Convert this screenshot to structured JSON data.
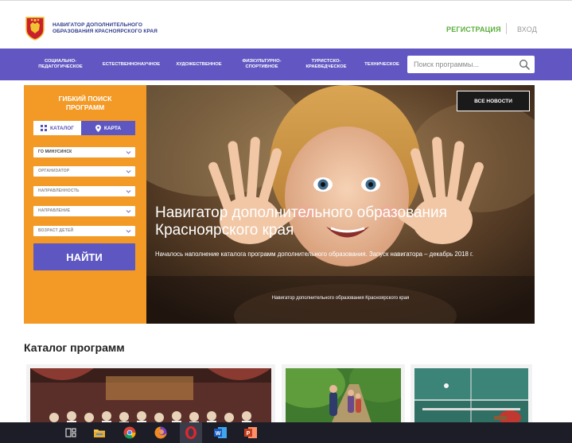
{
  "header": {
    "brand_line1": "НАВИГАТОР ДОПОЛНИТЕЛЬНОГО",
    "brand_line2": "ОБРАЗОВАНИЯ КРАСНОЯРСКОГО КРАЯ",
    "register_label": "РЕГИСТРАЦИЯ",
    "login_label": "ВХОД"
  },
  "nav": {
    "items": [
      {
        "line1": "СОЦИАЛЬНО-",
        "line2": "ПЕДАГОГИЧЕСКОЕ"
      },
      {
        "line1": "ЕСТЕСТВЕННОНАУЧНОЕ",
        "line2": ""
      },
      {
        "line1": "ХУДОЖЕСТВЕННОЕ",
        "line2": ""
      },
      {
        "line1": "ФИЗКУЛЬТУРНО-",
        "line2": "СПОРТИВНОЕ"
      },
      {
        "line1": "ТУРИСТСКО-",
        "line2": "КРАЕВЕДЧЕСКОЕ"
      },
      {
        "line1": "ТЕХНИЧЕСКОЕ",
        "line2": ""
      }
    ],
    "search_placeholder": "Поиск программы..."
  },
  "search_panel": {
    "title_line1": "ГИБКИЙ ПОИСК",
    "title_line2": "ПРОГРАММ",
    "tab_catalog": "КАТАЛОГ",
    "tab_map": "КАРТА",
    "selects": [
      {
        "label": "ГО МИНУСИНСК"
      },
      {
        "label": "ОРГАНИЗАТОР"
      },
      {
        "label": "НАПРАВЛЕННОСТЬ"
      },
      {
        "label": "НАПРАВЛЕНИЕ"
      },
      {
        "label": "ВОЗРАСТ ДЕТЕЙ"
      }
    ],
    "find_button": "НАЙТИ"
  },
  "hero": {
    "news_button": "ВСЕ НОВОСТИ",
    "title_line1": "Навигатор дополнительного образования",
    "title_line2": "Красноярского края",
    "subtitle": "Началось наполнение каталога программ дополнительного образования. Запуск навигатора – декабрь 2018 г.",
    "caption": "Навигатор дополнительного образования Красноярского края"
  },
  "catalog": {
    "title": "Каталог программ"
  },
  "colors": {
    "nav_bg": "#6257c2",
    "panel_orange": "#f39a26",
    "register_green": "#5aae3a",
    "brand_blue": "#2f3a8c"
  }
}
